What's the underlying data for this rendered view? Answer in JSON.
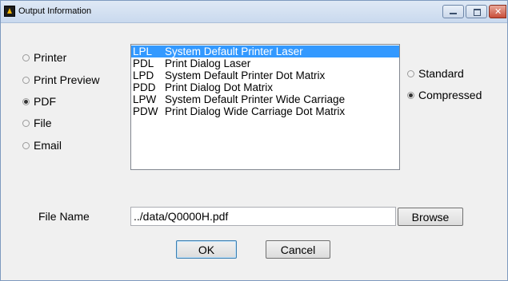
{
  "window": {
    "title": "Output Information"
  },
  "output_options": [
    {
      "label": "Printer",
      "selected": false
    },
    {
      "label": "Print Preview",
      "selected": false
    },
    {
      "label": "PDF",
      "selected": true
    },
    {
      "label": "File",
      "selected": false
    },
    {
      "label": "Email",
      "selected": false
    }
  ],
  "printers": [
    {
      "code": "LPL",
      "name": "System Default Printer Laser",
      "selected": true
    },
    {
      "code": "PDL",
      "name": "Print Dialog Laser",
      "selected": false
    },
    {
      "code": "LPD",
      "name": "System Default Printer Dot Matrix",
      "selected": false
    },
    {
      "code": "PDD",
      "name": "Print Dialog Dot Matrix",
      "selected": false
    },
    {
      "code": "LPW",
      "name": "System Default Printer Wide Carriage",
      "selected": false
    },
    {
      "code": "PDW",
      "name": "Print Dialog Wide Carriage Dot Matrix",
      "selected": false
    }
  ],
  "format_options": [
    {
      "label": "Standard",
      "selected": false
    },
    {
      "label": "Compressed",
      "selected": true
    }
  ],
  "file": {
    "label": "File Name",
    "value": "../data/Q0000H.pdf",
    "browse_label": "Browse"
  },
  "actions": {
    "ok_label": "OK",
    "cancel_label": "Cancel"
  }
}
